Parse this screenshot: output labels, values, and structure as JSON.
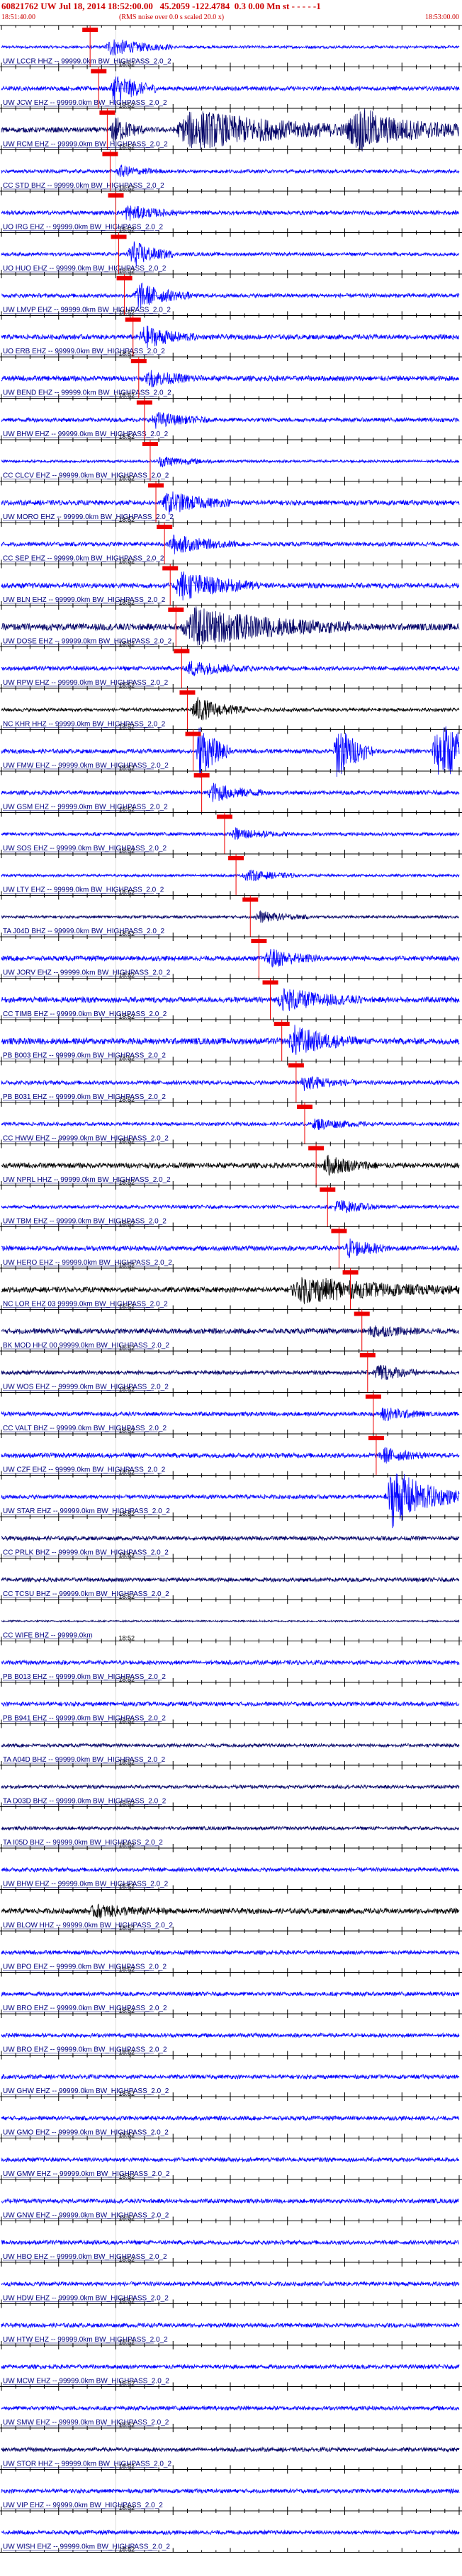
{
  "header": {
    "title": "60821762 UW Jul 18, 2014 18:52:00.00   45.2059 -122.4784  0.3 0.00 Mn st - - - - -1",
    "left_time": "18:51:40.00",
    "center_note": "(RMS noise over 0.0 s scaled 20.0 x)",
    "right_time": "18:53:00.00"
  },
  "colors": {
    "trace_black": "#000000",
    "trace_blue": "#0000ff",
    "trace_navy": "#000066",
    "pick": "#ee0000",
    "grid": "#000000"
  },
  "chart_data": {
    "type": "line",
    "title": "60821762 UW Jul 18, 2014 18:52:00.00   45.2059 -122.4784  0.3 0.00 Mn st - - - - -1",
    "xlabel": "",
    "ylabel": "",
    "time_tick_label": "18:52",
    "series": [
      {
        "label": "UW LCCR HHZ -- 99999.0km BW_HIGHPASS_2.0_2",
        "color": "blue",
        "pick_time": 15.5,
        "noise": 0.08,
        "events": [
          {
            "t": 18,
            "amp": 0.5,
            "dur": 12
          }
        ]
      },
      {
        "label": "UW JCW EHZ -- 99999.0km BW_HIGHPASS_2.0_2",
        "color": "blue",
        "pick_time": 17,
        "noise": 0.12,
        "events": [
          {
            "t": 19,
            "amp": 0.9,
            "dur": 8
          }
        ]
      },
      {
        "label": "UW RCM EHZ -- 99999.0km BW_HIGHPASS_2.0_2",
        "color": "navy",
        "pick_time": 18.5,
        "noise": 0.15,
        "events": [
          {
            "t": 19,
            "amp": 0.8,
            "dur": 6
          },
          {
            "t": 30,
            "amp": 1.1,
            "dur": 35
          },
          {
            "t": 60,
            "amp": 1.0,
            "dur": 25
          }
        ]
      },
      {
        "label": "CC STD BHZ -- 99999.0km BW_HIGHPASS_2.0_2",
        "color": "blue",
        "pick_time": 19,
        "noise": 0.1,
        "events": [
          {
            "t": 20,
            "amp": 0.3,
            "dur": 8
          }
        ]
      },
      {
        "label": "UO IRG EHZ -- 99999.0km BW_HIGHPASS_2.0_2",
        "color": "blue",
        "pick_time": 20,
        "noise": 0.12,
        "events": [
          {
            "t": 21,
            "amp": 0.4,
            "dur": 10
          }
        ]
      },
      {
        "label": "UO HUO EHZ -- 99999.0km BW_HIGHPASS_2.0_2",
        "color": "blue",
        "pick_time": 20.5,
        "noise": 0.1,
        "events": [
          {
            "t": 22,
            "amp": 0.8,
            "dur": 8
          }
        ]
      },
      {
        "label": "UW LMVP EHZ -- 99999.0km BW_HIGHPASS_2.0_2",
        "color": "blue",
        "pick_time": 21.5,
        "noise": 0.12,
        "events": [
          {
            "t": 23,
            "amp": 0.7,
            "dur": 10
          }
        ]
      },
      {
        "label": "UO ERB EHZ -- 99999.0km BW_HIGHPASS_2.0_2",
        "color": "blue",
        "pick_time": 23,
        "noise": 0.14,
        "events": [
          {
            "t": 24,
            "amp": 0.6,
            "dur": 10
          }
        ]
      },
      {
        "label": "UW BEND EHZ -- 99999.0km BW_HIGHPASS_2.0_2",
        "color": "blue",
        "pick_time": 24,
        "noise": 0.15,
        "events": [
          {
            "t": 25,
            "amp": 0.4,
            "dur": 10
          }
        ]
      },
      {
        "label": "UW BHW EHZ -- 99999.0km BW_HIGHPASS_2.0_2",
        "color": "blue",
        "pick_time": 25,
        "noise": 0.12,
        "events": [
          {
            "t": 26,
            "amp": 0.4,
            "dur": 10
          }
        ]
      },
      {
        "label": "CC CLCV EHZ -- 99999.0km BW_HIGHPASS_2.0_2",
        "color": "blue",
        "pick_time": 26,
        "noise": 0.08,
        "events": [
          {
            "t": 27,
            "amp": 0.3,
            "dur": 10
          }
        ]
      },
      {
        "label": "UW MORO EHZ -- 99999.0km BW_HIGHPASS_2.0_2",
        "color": "blue",
        "pick_time": 27,
        "noise": 0.14,
        "events": [
          {
            "t": 28,
            "amp": 0.6,
            "dur": 12
          }
        ]
      },
      {
        "label": "CC SEP EHZ -- 99999.0km BW_HIGHPASS_2.0_2",
        "color": "blue",
        "pick_time": 28.5,
        "noise": 0.12,
        "events": [
          {
            "t": 29,
            "amp": 0.5,
            "dur": 12
          }
        ]
      },
      {
        "label": "UW BLN EHZ -- 99999.0km BW_HIGHPASS_2.0_2",
        "color": "blue",
        "pick_time": 29.5,
        "noise": 0.15,
        "events": [
          {
            "t": 30,
            "amp": 0.8,
            "dur": 15
          }
        ]
      },
      {
        "label": "UW DOSE EHZ -- 99999.0km BW_HIGHPASS_2.0_2",
        "color": "navy",
        "pick_time": 30.5,
        "noise": 0.2,
        "events": [
          {
            "t": 31,
            "amp": 1.0,
            "dur": 30
          }
        ]
      },
      {
        "label": "UW RPW EHZ -- 99999.0km BW_HIGHPASS_2.0_2",
        "color": "blue",
        "pick_time": 31.5,
        "noise": 0.12,
        "events": [
          {
            "t": 32,
            "amp": 0.4,
            "dur": 12
          }
        ]
      },
      {
        "label": "NC KHR HHZ -- 99999.0km BW_HIGHPASS_2.0_2",
        "color": "black",
        "pick_time": 32.5,
        "noise": 0.1,
        "events": [
          {
            "t": 33,
            "amp": 0.7,
            "dur": 10
          }
        ]
      },
      {
        "label": "UW FMW EHZ -- 99999.0km BW_HIGHPASS_2.0_2",
        "color": "blue",
        "pick_time": 33.5,
        "noise": 0.12,
        "events": [
          {
            "t": 34,
            "amp": 1.6,
            "dur": 6
          },
          {
            "t": 58,
            "amp": 1.6,
            "dur": 7
          },
          {
            "t": 75,
            "amp": 1.6,
            "dur": 16
          }
        ]
      },
      {
        "label": "UW GSM EHZ -- 99999.0km BW_HIGHPASS_2.0_2",
        "color": "blue",
        "pick_time": 35,
        "noise": 0.12,
        "events": [
          {
            "t": 36,
            "amp": 0.5,
            "dur": 10
          }
        ]
      },
      {
        "label": "UW SOS EHZ -- 99999.0km BW_HIGHPASS_2.0_2",
        "color": "blue",
        "pick_time": 39,
        "noise": 0.1,
        "events": [
          {
            "t": 40,
            "amp": 0.3,
            "dur": 10
          }
        ]
      },
      {
        "label": "UW LTY EHZ -- 99999.0km BW_HIGHPASS_2.0_2",
        "color": "blue",
        "pick_time": 41,
        "noise": 0.08,
        "events": [
          {
            "t": 42,
            "amp": 0.3,
            "dur": 10
          }
        ]
      },
      {
        "label": "TA J04D BHZ -- 99999.0km BW_HIGHPASS_2.0_2",
        "color": "navy",
        "pick_time": 43.5,
        "noise": 0.08,
        "events": [
          {
            "t": 44,
            "amp": 0.3,
            "dur": 10
          }
        ]
      },
      {
        "label": "UW JORV EHZ -- 99999.0km BW_HIGHPASS_2.0_2",
        "color": "blue",
        "pick_time": 45,
        "noise": 0.14,
        "events": [
          {
            "t": 46,
            "amp": 0.5,
            "dur": 10
          }
        ]
      },
      {
        "label": "CC TIMB EHZ -- 99999.0km BW_HIGHPASS_2.0_2",
        "color": "blue",
        "pick_time": 47,
        "noise": 0.16,
        "events": [
          {
            "t": 48,
            "amp": 0.6,
            "dur": 15
          }
        ]
      },
      {
        "label": "PB B003 EHZ -- 99999.0km BW_HIGHPASS_2.0_2",
        "color": "blue",
        "pick_time": 49,
        "noise": 0.18,
        "events": [
          {
            "t": 50,
            "amp": 0.8,
            "dur": 12
          }
        ]
      },
      {
        "label": "PB B031 EHZ -- 99999.0km BW_HIGHPASS_2.0_2",
        "color": "blue",
        "pick_time": 51.5,
        "noise": 0.12,
        "events": [
          {
            "t": 52,
            "amp": 0.4,
            "dur": 10
          }
        ]
      },
      {
        "label": "CC HWW EHZ -- 99999.0km BW_HIGHPASS_2.0_2",
        "color": "blue",
        "pick_time": 53,
        "noise": 0.1,
        "events": [
          {
            "t": 54,
            "amp": 0.3,
            "dur": 10
          }
        ]
      },
      {
        "label": "UW NPRL HHZ -- 99999.0km BW_HIGHPASS_2.0_2",
        "color": "black",
        "pick_time": 55,
        "noise": 0.15,
        "events": [
          {
            "t": 56,
            "amp": 0.5,
            "dur": 10
          }
        ]
      },
      {
        "label": "UW TBM EHZ -- 99999.0km BW_HIGHPASS_2.0_2",
        "color": "blue",
        "pick_time": 57,
        "noise": 0.1,
        "events": [
          {
            "t": 58,
            "amp": 0.4,
            "dur": 8
          }
        ]
      },
      {
        "label": "UW HERO EHZ -- 99999.0km BW_HIGHPASS_2.0_2",
        "color": "blue",
        "pick_time": 59,
        "noise": 0.14,
        "events": [
          {
            "t": 60,
            "amp": 0.5,
            "dur": 8
          }
        ]
      },
      {
        "label": "NC LOR EHZ 03 99999.0km BW_HIGHPASS_2.0_2",
        "color": "black",
        "pick_time": 61,
        "noise": 0.15,
        "events": [
          {
            "t": 50,
            "amp": 0.7,
            "dur": 30
          }
        ]
      },
      {
        "label": "BK MOD HHZ 00 99999.0km BW_HIGHPASS_2.0_2",
        "color": "navy",
        "pick_time": 63,
        "noise": 0.15,
        "events": [
          {
            "t": 64,
            "amp": 0.3,
            "dur": 10
          }
        ]
      },
      {
        "label": "UW WOS EHZ -- 99999.0km BW_HIGHPASS_2.0_2",
        "color": "navy",
        "pick_time": 64,
        "noise": 0.12,
        "events": [
          {
            "t": 65,
            "amp": 0.5,
            "dur": 8
          }
        ]
      },
      {
        "label": "CC VALT BHZ -- 99999.0km BW_HIGHPASS_2.0_2",
        "color": "blue",
        "pick_time": 65,
        "noise": 0.12,
        "events": [
          {
            "t": 66,
            "amp": 0.4,
            "dur": 8
          }
        ]
      },
      {
        "label": "UW CZF EHZ -- 99999.0km BW_HIGHPASS_2.0_2",
        "color": "blue",
        "pick_time": 65.5,
        "noise": 0.14,
        "events": [
          {
            "t": 66,
            "amp": 0.4,
            "dur": 8
          }
        ]
      },
      {
        "label": "UW STAR EHZ -- 99999.0km BW_HIGHPASS_2.0_2",
        "color": "blue",
        "pick_time": null,
        "noise": 0.12,
        "events": [
          {
            "t": 67,
            "amp": 1.7,
            "dur": 13
          }
        ]
      },
      {
        "label": "CC PRLK BHZ -- 99999.0km BW_HIGHPASS_2.0_2",
        "color": "navy",
        "pick_time": null,
        "noise": 0.12,
        "events": []
      },
      {
        "label": "CC TCSU BHZ -- 99999.0km BW_HIGHPASS_2.0_2",
        "color": "navy",
        "pick_time": null,
        "noise": 0.12,
        "events": []
      },
      {
        "label": "CC WIFE BHZ -- 99999.0km",
        "color": "navy",
        "pick_time": null,
        "noise": 0.05,
        "events": []
      },
      {
        "label": "PB B013 EHZ -- 99999.0km BW_HIGHPASS_2.0_2",
        "color": "blue",
        "pick_time": null,
        "noise": 0.12,
        "events": []
      },
      {
        "label": "PB B941 EHZ -- 99999.0km BW_HIGHPASS_2.0_2",
        "color": "blue",
        "pick_time": null,
        "noise": 0.12,
        "events": []
      },
      {
        "label": "TA A04D BHZ -- 99999.0km BW_HIGHPASS_2.0_2",
        "color": "navy",
        "pick_time": null,
        "noise": 0.1,
        "events": []
      },
      {
        "label": "TA D03D BHZ -- 99999.0km BW_HIGHPASS_2.0_2",
        "color": "navy",
        "pick_time": null,
        "noise": 0.1,
        "events": []
      },
      {
        "label": "TA I05D BHZ -- 99999.0km BW_HIGHPASS_2.0_2",
        "color": "navy",
        "pick_time": null,
        "noise": 0.1,
        "events": []
      },
      {
        "label": "UW BHW EHZ -- 99999.0km BW_HIGHPASS_2.0_2",
        "color": "blue",
        "pick_time": null,
        "noise": 0.12,
        "events": []
      },
      {
        "label": "UW BLOW HHZ -- 99999.0km BW_HIGHPASS_2.0_2",
        "color": "black",
        "pick_time": null,
        "noise": 0.15,
        "events": [
          {
            "t": 15,
            "amp": 0.3,
            "dur": 15
          }
        ]
      },
      {
        "label": "UW BPO EHZ -- 99999.0km BW_HIGHPASS_2.0_2",
        "color": "blue",
        "pick_time": null,
        "noise": 0.12,
        "events": []
      },
      {
        "label": "UW BRO EHZ -- 99999.0km BW_HIGHPASS_2.0_2",
        "color": "blue",
        "pick_time": null,
        "noise": 0.12,
        "events": []
      },
      {
        "label": "UW BRO EHZ -- 99999.0km BW_HIGHPASS_2.0_2",
        "color": "blue",
        "pick_time": null,
        "noise": 0.12,
        "events": []
      },
      {
        "label": "UW GHW EHZ -- 99999.0km BW_HIGHPASS_2.0_2",
        "color": "blue",
        "pick_time": null,
        "noise": 0.12,
        "events": []
      },
      {
        "label": "UW GMO EHZ -- 99999.0km BW_HIGHPASS_2.0_2",
        "color": "blue",
        "pick_time": null,
        "noise": 0.12,
        "events": []
      },
      {
        "label": "UW GMW EHZ -- 99999.0km BW_HIGHPASS_2.0_2",
        "color": "blue",
        "pick_time": null,
        "noise": 0.12,
        "events": []
      },
      {
        "label": "UW GNW EHZ -- 99999.0km BW_HIGHPASS_2.0_2",
        "color": "blue",
        "pick_time": null,
        "noise": 0.12,
        "events": []
      },
      {
        "label": "UW HBO EHZ -- 99999.0km BW_HIGHPASS_2.0_2",
        "color": "blue",
        "pick_time": null,
        "noise": 0.12,
        "events": []
      },
      {
        "label": "UW HDW EHZ -- 99999.0km BW_HIGHPASS_2.0_2",
        "color": "blue",
        "pick_time": null,
        "noise": 0.12,
        "events": []
      },
      {
        "label": "UW HTW EHZ -- 99999.0km BW_HIGHPASS_2.0_2",
        "color": "blue",
        "pick_time": null,
        "noise": 0.12,
        "events": []
      },
      {
        "label": "UW MCW EHZ -- 99999.0km BW_HIGHPASS_2.0_2",
        "color": "blue",
        "pick_time": null,
        "noise": 0.12,
        "events": []
      },
      {
        "label": "UW SMW EHZ -- 99999.0km BW_HIGHPASS_2.0_2",
        "color": "blue",
        "pick_time": null,
        "noise": 0.12,
        "events": []
      },
      {
        "label": "UW STOR HHZ -- 99999.0km BW_HIGHPASS_2.0_2",
        "color": "navy",
        "pick_time": null,
        "noise": 0.12,
        "events": []
      },
      {
        "label": "UW VIP EHZ -- 99999.0km BW_HIGHPASS_2.0_2",
        "color": "blue",
        "pick_time": null,
        "noise": 0.12,
        "events": []
      },
      {
        "label": "UW WISH EHZ -- 99999.0km BW_HIGHPASS_2.0_2",
        "color": "blue",
        "pick_time": null,
        "noise": 0.12,
        "events": []
      }
    ]
  }
}
